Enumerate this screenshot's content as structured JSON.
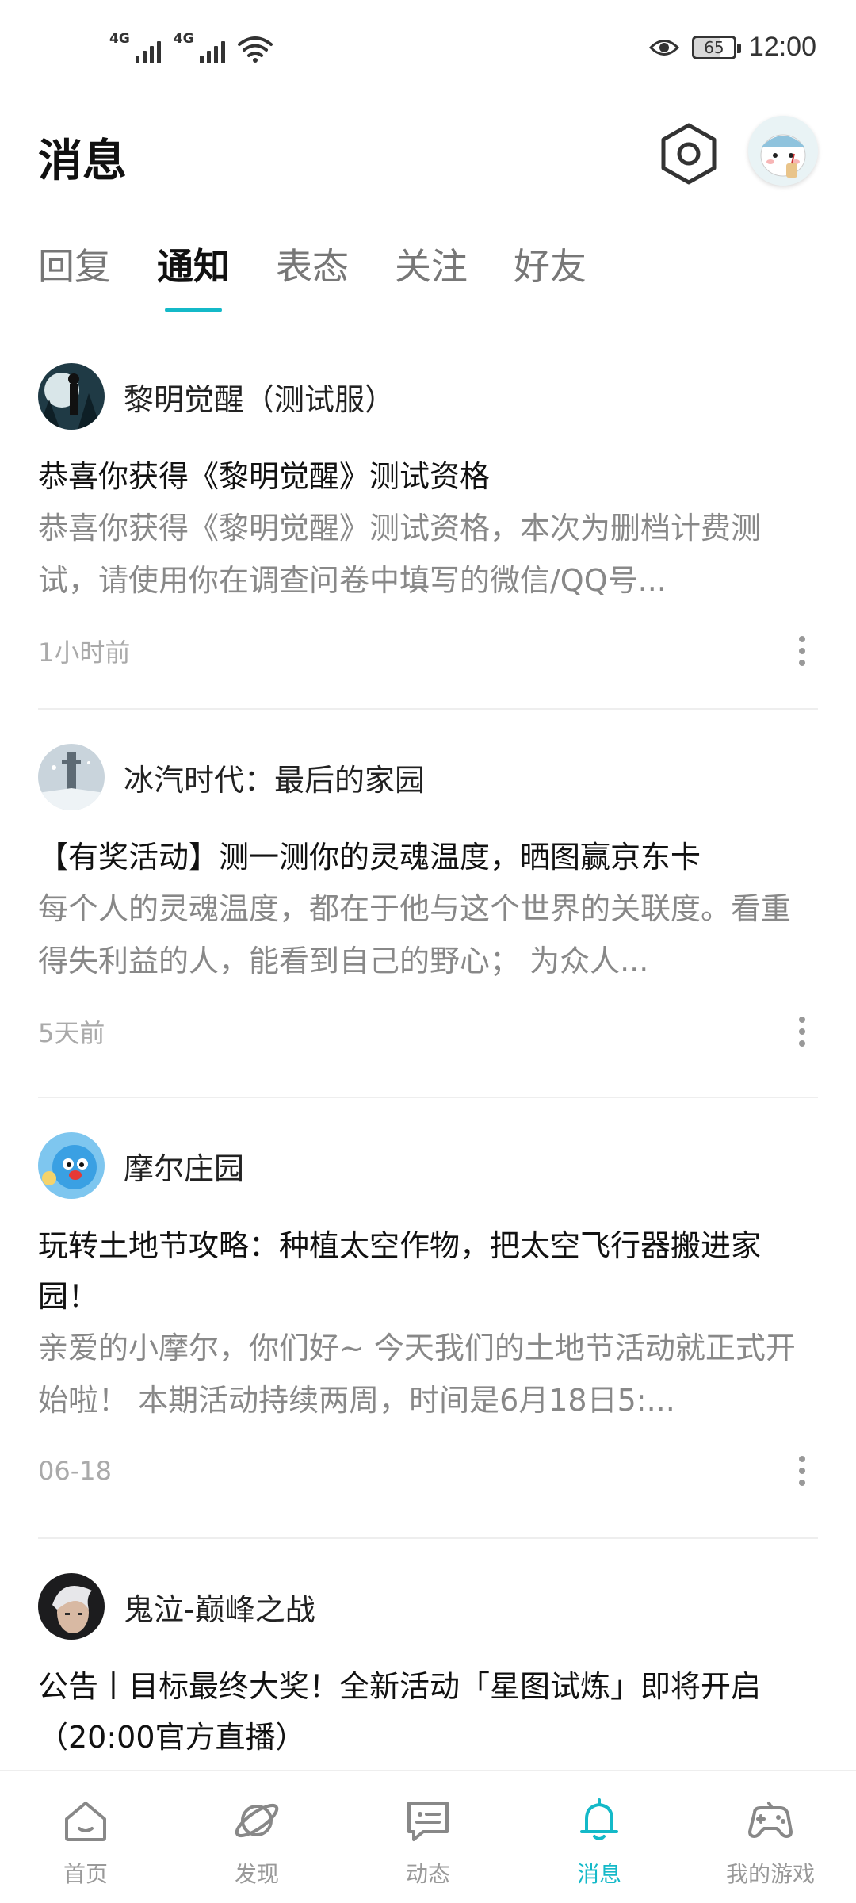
{
  "status_bar": {
    "sim1": "4G",
    "sim2": "4G",
    "battery": "65",
    "time": "12:00"
  },
  "header": {
    "title": "消息"
  },
  "tabs": [
    {
      "label": "回复"
    },
    {
      "label": "通知"
    },
    {
      "label": "表态"
    },
    {
      "label": "关注"
    },
    {
      "label": "好友"
    }
  ],
  "notifications": [
    {
      "game": "黎明觉醒（测试服）",
      "title": "恭喜你获得《黎明觉醒》测试资格",
      "body": "恭喜你获得《黎明觉醒》测试资格，本次为删档计费测试，请使用你在调查问卷中填写的微信/QQ号...",
      "time": "1小时前"
    },
    {
      "game": "冰汽时代：最后的家园",
      "title": "【有奖活动】测一测你的灵魂温度，晒图赢京东卡",
      "body": "每个人的灵魂温度，都在于他与这个世界的关联度。看重得失利益的人，能看到自己的野心； 为众人...",
      "time": "5天前"
    },
    {
      "game": "摩尔庄园",
      "title": "玩转土地节攻略：种植太空作物，把太空飞行器搬进家园！",
      "body": "亲爱的小摩尔，你们好~ 今天我们的土地节活动就正式开始啦！ 本期活动持续两周，时间是6月18日5:...",
      "time": "06-18"
    },
    {
      "game": "鬼泣-巅峰之战",
      "title": "公告丨目标最终大奖！全新活动「星图试炼」即将开启（20:00官方直播）"
    }
  ],
  "bottom_nav": [
    {
      "label": "首页",
      "icon": "home-icon"
    },
    {
      "label": "发现",
      "icon": "planet-icon"
    },
    {
      "label": "动态",
      "icon": "chat-bubble-icon"
    },
    {
      "label": "消息",
      "icon": "bell-icon",
      "active": true
    },
    {
      "label": "我的游戏",
      "icon": "gamepad-icon"
    }
  ],
  "colors": {
    "accent": "#14b9c8",
    "text_primary": "#111111",
    "text_secondary": "#888888"
  }
}
